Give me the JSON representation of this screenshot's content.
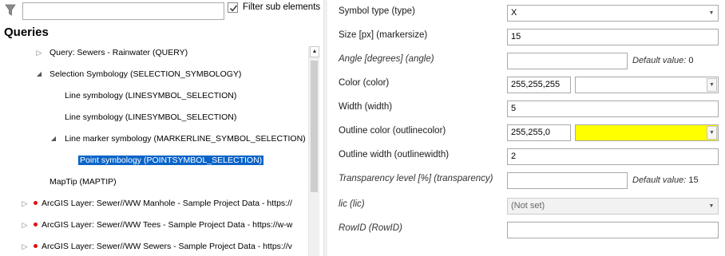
{
  "filter": {
    "input_value": "",
    "checkbox_checked": true,
    "checkbox_label": "Filter sub elements"
  },
  "queries_title": "Queries",
  "tree": {
    "n1": "Query: Sewers - Rainwater (QUERY)",
    "n2": "Selection Symbology (SELECTION_SYMBOLOGY)",
    "n3": "Line symbology (LINESYMBOL_SELECTION)",
    "n4": "Line symbology (LINESYMBOL_SELECTION)",
    "n5": "Line marker symbology (MARKERLINE_SYMBOL_SELECTION)",
    "n6": "Point symbology (POINTSYMBOL_SELECTION)",
    "n7": "MapTip (MAPTIP)",
    "n8": "ArcGIS Layer: Sewer//WW Manhole - Sample Project Data - https://",
    "n9": "ArcGIS Layer: Sewer//WW Tees - Sample Project Data - https://w-w",
    "n10": "ArcGIS Layer: Sewer//WW Sewers - Sample Project Data - https://v",
    "layer_dot_color": "#e01010"
  },
  "props": {
    "symbol_type": {
      "label": "Symbol type (type)",
      "value": "X"
    },
    "size": {
      "label": "Size [px] (markersize)",
      "value": "15"
    },
    "angle": {
      "label": "Angle [degrees] (angle)",
      "value": "",
      "default_label": "Default value:",
      "default_value": "0"
    },
    "color": {
      "label": "Color (color)",
      "value": "255,255,255",
      "swatch": "#ffffff"
    },
    "width": {
      "label": "Width (width)",
      "value": "5"
    },
    "outline_color": {
      "label": "Outline color (outlinecolor)",
      "value": "255,255,0",
      "swatch": "#ffff00"
    },
    "outline_width": {
      "label": "Outline width (outlinewidth)",
      "value": "2"
    },
    "transparency": {
      "label": "Transparency level [%] (transparency)",
      "value": "",
      "default_label": "Default value:",
      "default_value": "15"
    },
    "lic": {
      "label": "lic (lic)",
      "value": "(Not set)"
    },
    "rowid": {
      "label": "RowID (RowID)",
      "value": ""
    }
  }
}
